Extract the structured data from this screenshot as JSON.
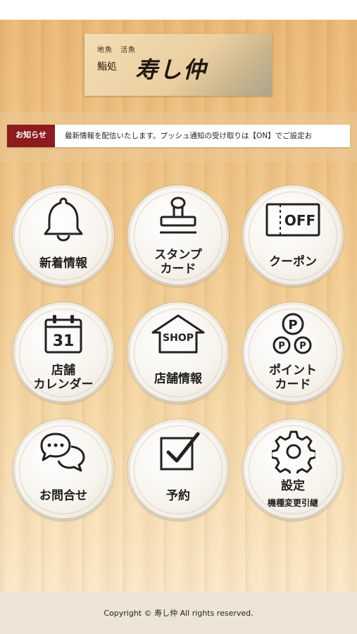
{
  "logo": {
    "sub_text": "地魚　活魚",
    "main_text": "鮨処",
    "brand_text": "寿し仲"
  },
  "news": {
    "label": "お知らせ",
    "text": "最新情報を配信いたします。プッシュ通知の受け取りは【ON】でご設定お"
  },
  "menu": {
    "items": [
      {
        "line1": "新着情報",
        "line2": "",
        "icon": "bell-icon"
      },
      {
        "line1": "スタンプ",
        "line2": "カード",
        "icon": "stamp-icon"
      },
      {
        "line1": "クーポン",
        "line2": "",
        "icon": "coupon-off-icon",
        "icon_text": "OFF"
      },
      {
        "line1": "店舗",
        "line2": "カレンダー",
        "icon": "calendar-icon",
        "icon_text": "31"
      },
      {
        "line1": "店舗情報",
        "line2": "",
        "icon": "shop-icon",
        "icon_text": "SHOP"
      },
      {
        "line1": "ポイント",
        "line2": "カード",
        "icon": "points-icon",
        "icon_text": "P"
      },
      {
        "line1": "お問合せ",
        "line2": "",
        "icon": "chat-bubbles-icon"
      },
      {
        "line1": "予約",
        "line2": "",
        "icon": "checkbox-icon"
      },
      {
        "line1": "設定",
        "line2": "機種変更引継",
        "icon": "gear-icon"
      }
    ]
  },
  "footer": {
    "copyright": "Copyright © 寿し仲 All rights reserved."
  }
}
